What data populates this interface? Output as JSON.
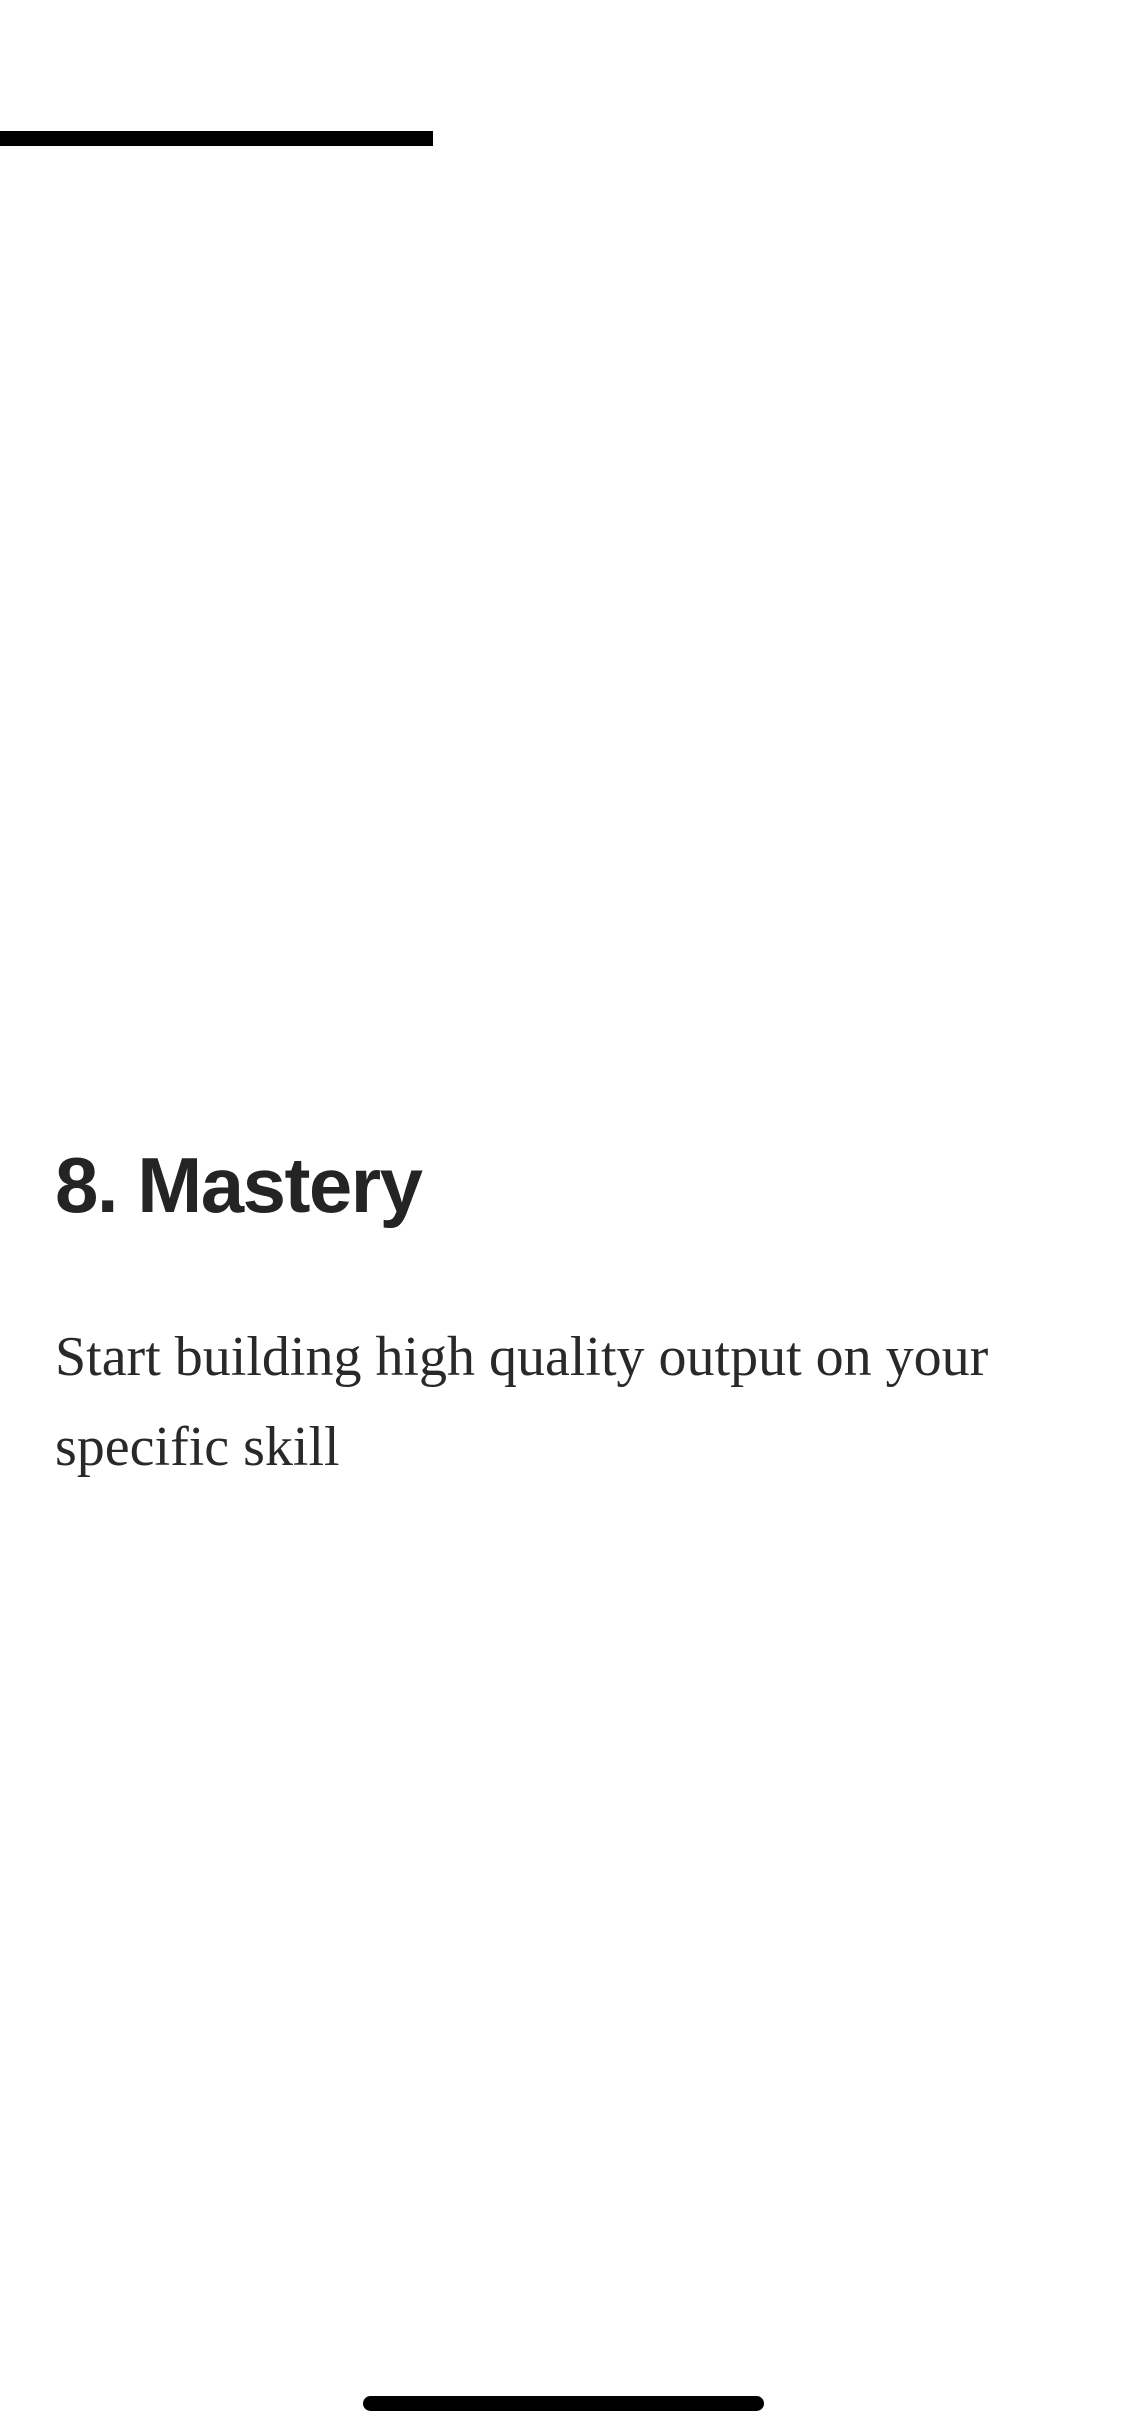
{
  "progress": {
    "fraction": 0.385,
    "color": "#000000"
  },
  "section": {
    "title": "8. Mastery",
    "body": "Start building high quality output on your specific skill"
  },
  "system": {
    "home_indicator_color": "#000000"
  }
}
